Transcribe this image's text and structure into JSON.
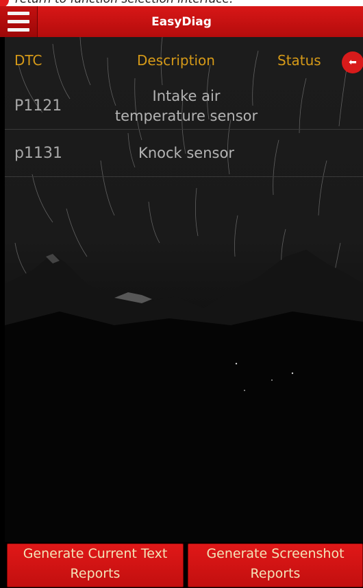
{
  "caption": {
    "text": "return to function selection interface."
  },
  "app": {
    "title": "EasyDiag"
  },
  "table": {
    "headers": {
      "dtc": "DTC",
      "description": "Description",
      "status": "Status"
    },
    "rows": [
      {
        "code": "P1121",
        "description_line1": "Intake air",
        "description_line2": "temperature sensor"
      },
      {
        "code": "p1131",
        "description_line1": "Knock sensor",
        "description_line2": ""
      }
    ]
  },
  "buttons": {
    "text_report": {
      "line1": "Generate Current Text",
      "line2": "Reports"
    },
    "screenshot_report": {
      "line1": "Generate Screenshot",
      "line2": "Reports"
    }
  },
  "icons": {
    "menu": "hamburger-menu-icon",
    "back": "back-arrow-icon"
  },
  "colors": {
    "accent": "#d81717",
    "header_text": "#d69a18"
  }
}
